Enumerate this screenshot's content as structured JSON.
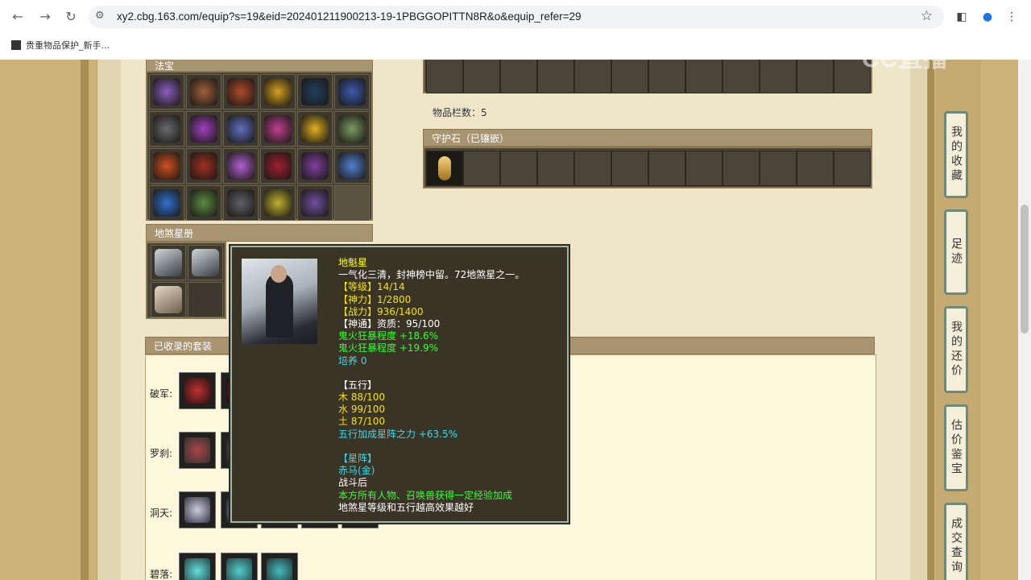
{
  "browser": {
    "url": "xy2.cbg.163.com/equip?s=19&eid=202401211900213-19-1PBGGOPITTN8R&o&equip_refer=29",
    "bookmark_label": "贵重物品保护_新手..."
  },
  "sections": {
    "fabao_title": "法宝",
    "disha_title": "地煞星册",
    "guard_title": "守护石（已镶嵌）",
    "item_count_label": "物品栏数：5",
    "suit_title": "已收录的套装"
  },
  "suits": [
    {
      "label": "破军:"
    },
    {
      "label": "罗刹:"
    },
    {
      "label": "洞天:"
    },
    {
      "label": "碧落:"
    }
  ],
  "sidebar": {
    "items": [
      "我的收藏",
      "足迹",
      "我的还价",
      "估价鉴宝",
      "成交查询"
    ]
  },
  "watermark": "CC直播",
  "tooltip": {
    "name": "地魁星",
    "desc": "一气化三清，封神榜中留。72地煞星之一。",
    "level": "【等级】14/14",
    "shenli": "【神力】1/2800",
    "zhanli": "【战力】936/1400",
    "shentong": "【神通】资质：95/100",
    "attr1": "鬼火狂暴程度 +18.6%",
    "attr2": "鬼火狂暴程度 +19.9%",
    "peiyang": "培养 0",
    "wuxing_title": "【五行】",
    "mu": "木 88/100",
    "shui": "水 99/100",
    "tu": "土 87/100",
    "wuxing_bonus": "五行加成星阵之力 +63.5%",
    "xingzhen_title": "【星阵】",
    "xingzhen_name": "赤马(金)",
    "xingzhen_time": "战斗后",
    "xingzhen_effect": "本方所有人物、召唤兽获得一定经验加成",
    "xingzhen_note": "地煞星等级和五行越高效果越好"
  },
  "colors": {
    "panel_bg": "#efe6ca",
    "header_bg": "#a89470",
    "tooltip_bg": "#3a3427",
    "accent_yellow": "#ffff00",
    "accent_green": "#33ff33",
    "accent_cyan": "#33ddee"
  }
}
